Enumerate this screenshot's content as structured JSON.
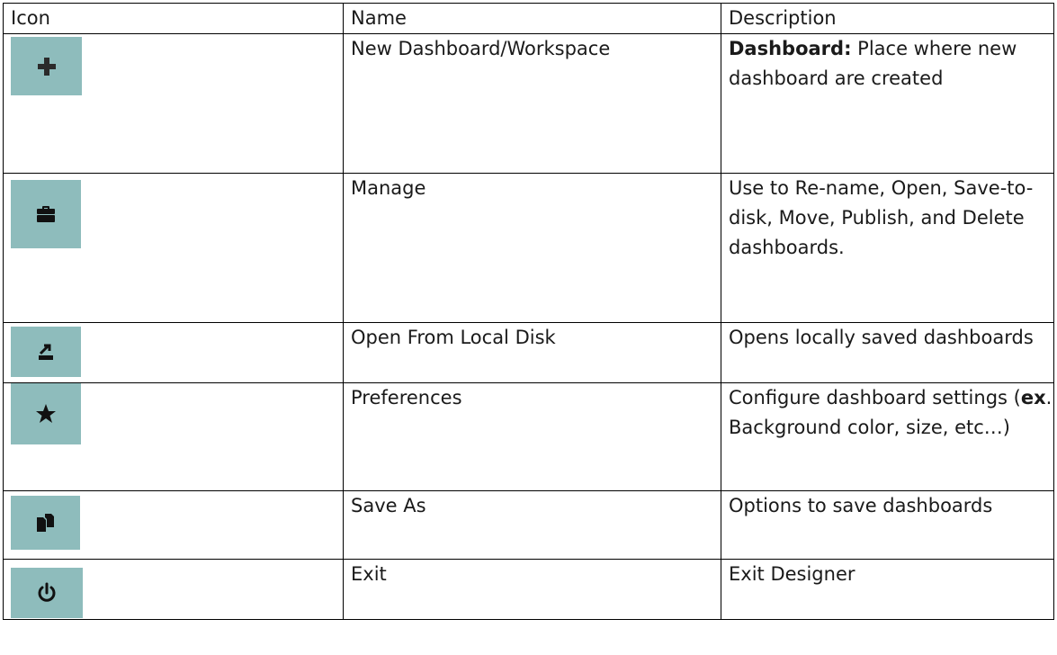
{
  "table": {
    "headers": {
      "icon": "Icon",
      "name": "Name",
      "description": "Description"
    },
    "rows": [
      {
        "icon": "plus-icon",
        "name": "New Dashboard/Workspace",
        "desc_bold": "Dashboard:",
        "desc_text": " Place where new dashboard are created"
      },
      {
        "icon": "briefcase-icon",
        "name": "Manage",
        "desc_text": "Use to Re-name, Open, Save-to-disk, Move, Publish, and Delete dashboards."
      },
      {
        "icon": "open-from-disk-icon",
        "name": "Open From Local Disk",
        "desc_text": "Opens locally saved dashboards"
      },
      {
        "icon": "star-icon",
        "name": "Preferences",
        "desc_prefix": "Configure dashboard settings (",
        "desc_bold": "ex",
        "desc_suffix": ". Background color, size, etc…)"
      },
      {
        "icon": "copy-files-icon",
        "name": "Save As",
        "desc_text": "Options to save dashboards"
      },
      {
        "icon": "power-icon",
        "name": "Exit",
        "desc_text": "Exit Designer"
      }
    ]
  },
  "colors": {
    "icon_tile": "#8ebcbc",
    "icon_glyph": "#1a1a1a",
    "border": "#000000"
  }
}
